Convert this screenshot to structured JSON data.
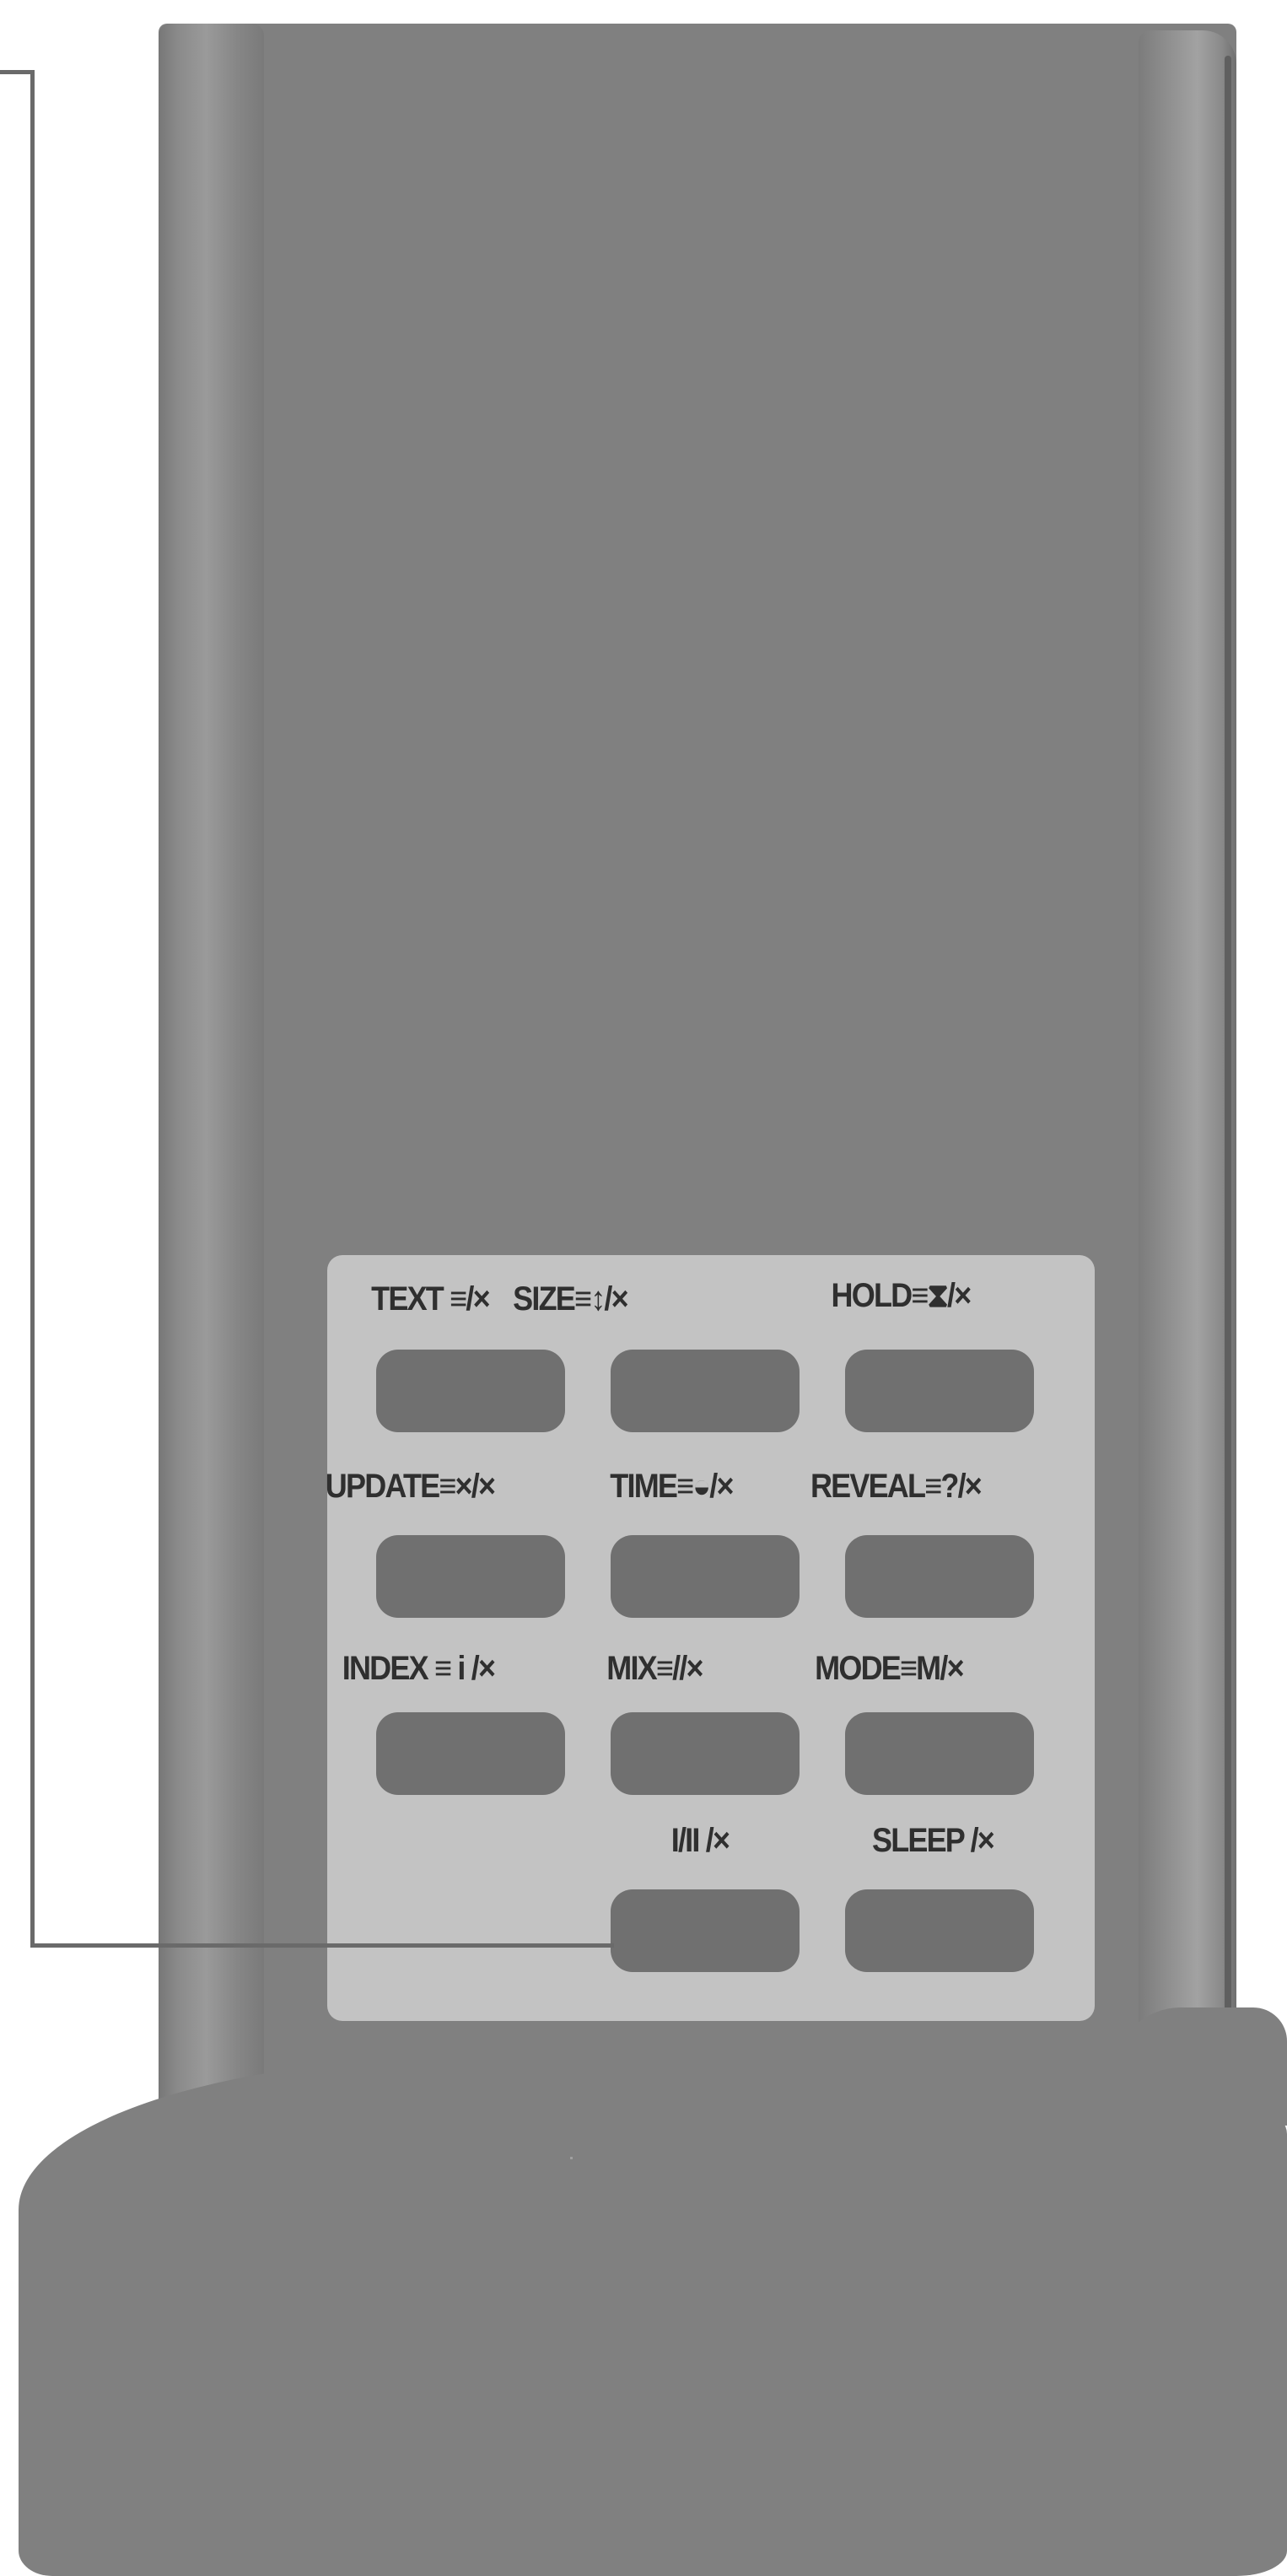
{
  "teletext_panel": {
    "buttons": [
      {
        "label": "TEXT ≡/×"
      },
      {
        "label": "SIZE≡↕/×"
      },
      {
        "label": "HOLD≡⧗/×"
      },
      {
        "label": "UPDATE≡×/×"
      },
      {
        "label": "TIME≡◒/×"
      },
      {
        "label": "REVEAL≡?/×"
      },
      {
        "label": "INDEX ≡ i /×"
      },
      {
        "label": "MIX≡//×"
      },
      {
        "label": "MODE≡M/×"
      },
      {
        "label": "I/II /×"
      },
      {
        "label": "SLEEP /×"
      }
    ]
  },
  "colors": {
    "remote_body": "#808080",
    "panel": "#c3c3c3",
    "button": "#707070",
    "label_text": "#2f2f2f",
    "callout_line": "#6a6a6a"
  }
}
